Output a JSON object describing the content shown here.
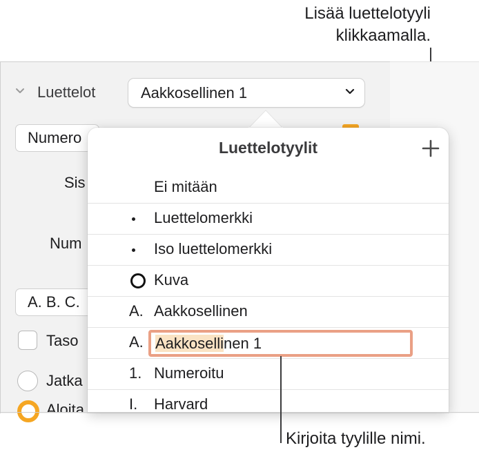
{
  "callouts": {
    "add_style_line1": "Lisää luettelotyyli",
    "add_style_line2": "klikkaamalla.",
    "name_style": "Kirjoita tyylille nimi."
  },
  "inspector": {
    "section_label": "Luettelot",
    "style_popup_value": "Aakkosellinen 1",
    "numbered_field": "Numero",
    "indent_label": "Sis",
    "number_label": "Num",
    "format_field": "A. B. C.",
    "tiered_checkbox_label": "Taso",
    "continue_radio_label": "Jatka",
    "start_radio_label": "Aloita"
  },
  "popover": {
    "title": "Luettelotyylit",
    "rows": [
      {
        "marker": "",
        "label": "Ei mitään"
      },
      {
        "marker": "•",
        "label": "Luettelomerkki"
      },
      {
        "marker": "•",
        "label": "Iso luettelomerkki"
      },
      {
        "marker": "circle",
        "label": "Kuva"
      },
      {
        "marker": "A.",
        "label": "Aakkosellinen"
      },
      {
        "marker": "A.",
        "label_selected": "Aakkoselli",
        "label_rest": "nen 1"
      },
      {
        "marker": "1.",
        "label": "Numeroitu"
      },
      {
        "marker": "I.",
        "label": "Harvard"
      }
    ]
  },
  "colors": {
    "accent": "#f5a623",
    "edit_border": "#eaa085",
    "selection": "#fae3c4"
  }
}
